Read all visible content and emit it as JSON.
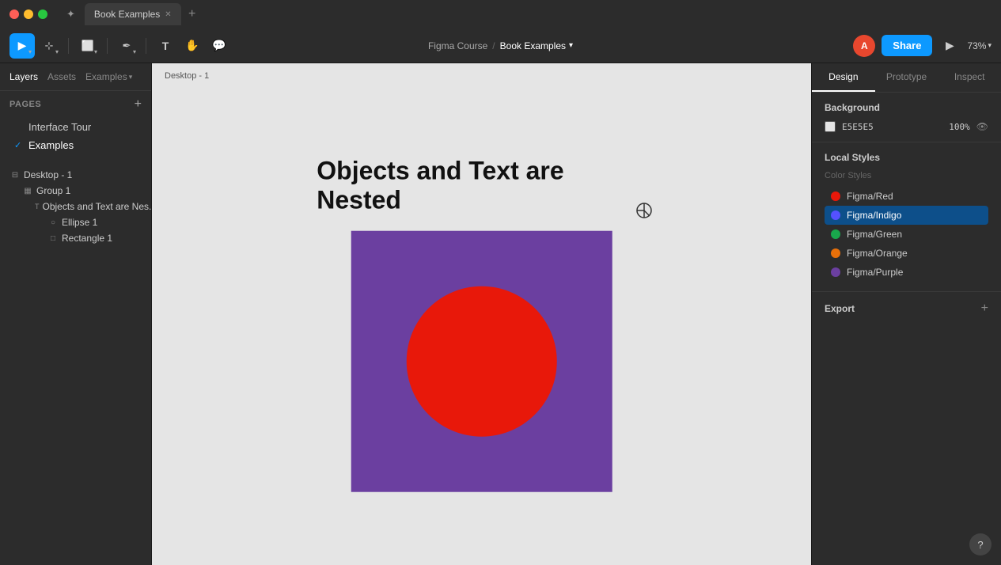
{
  "titlebar": {
    "tab_title": "Book Examples",
    "figma_icon": "✦"
  },
  "toolbar": {
    "breadcrumb_parent": "Figma Course",
    "breadcrumb_separator": "/",
    "breadcrumb_current": "Book Examples",
    "breadcrumb_chevron": "▾",
    "zoom_level": "73%",
    "share_label": "Share",
    "avatar_initial": "A",
    "tools": [
      {
        "name": "select",
        "icon": "▶",
        "active": true
      },
      {
        "name": "scale",
        "icon": "⊹"
      },
      {
        "name": "frame",
        "icon": "⬜"
      },
      {
        "name": "pen",
        "icon": "✒"
      },
      {
        "name": "text",
        "icon": "T"
      },
      {
        "name": "hand",
        "icon": "✋"
      },
      {
        "name": "comment",
        "icon": "💬"
      }
    ]
  },
  "left_sidebar": {
    "tabs": [
      {
        "label": "Layers",
        "active": true
      },
      {
        "label": "Assets",
        "active": false
      },
      {
        "label": "Examples",
        "active": false,
        "has_chevron": true
      }
    ],
    "pages_title": "Pages",
    "pages": [
      {
        "label": "Interface Tour",
        "active": false
      },
      {
        "label": "Examples",
        "active": true
      }
    ],
    "layers_title": "Desktop - 1",
    "layers": [
      {
        "label": "Group 1",
        "indent": 1,
        "icon": "▦"
      },
      {
        "label": "Objects and Text are Nes...",
        "indent": 2,
        "icon": "T"
      },
      {
        "label": "Ellipse 1",
        "indent": 3,
        "icon": "○"
      },
      {
        "label": "Rectangle 1",
        "indent": 3,
        "icon": "□"
      }
    ]
  },
  "canvas": {
    "frame_label": "Desktop - 1",
    "title": "Objects and Text are Nested",
    "frame_bg": "#6b3fa0",
    "circle_color": "#e8180a",
    "bg_color": "#e5e5e5"
  },
  "right_panel": {
    "tabs": [
      {
        "label": "Design",
        "active": true
      },
      {
        "label": "Prototype",
        "active": false
      },
      {
        "label": "Inspect",
        "active": false
      }
    ],
    "background_title": "Background",
    "bg_color_hex": "E5E5E5",
    "bg_opacity": "100%",
    "local_styles_title": "Local Styles",
    "color_styles_label": "Color Styles",
    "color_styles": [
      {
        "name": "Figma/Red",
        "color": "#e8180a",
        "active": false
      },
      {
        "name": "Figma/Indigo",
        "color": "#5551ff",
        "active": true
      },
      {
        "name": "Figma/Green",
        "color": "#19a84c",
        "active": false
      },
      {
        "name": "Figma/Orange",
        "color": "#e8700a",
        "active": false
      },
      {
        "name": "Figma/Purple",
        "color": "#6b3fa0",
        "active": false
      }
    ],
    "export_title": "Export"
  },
  "help_btn": "?"
}
